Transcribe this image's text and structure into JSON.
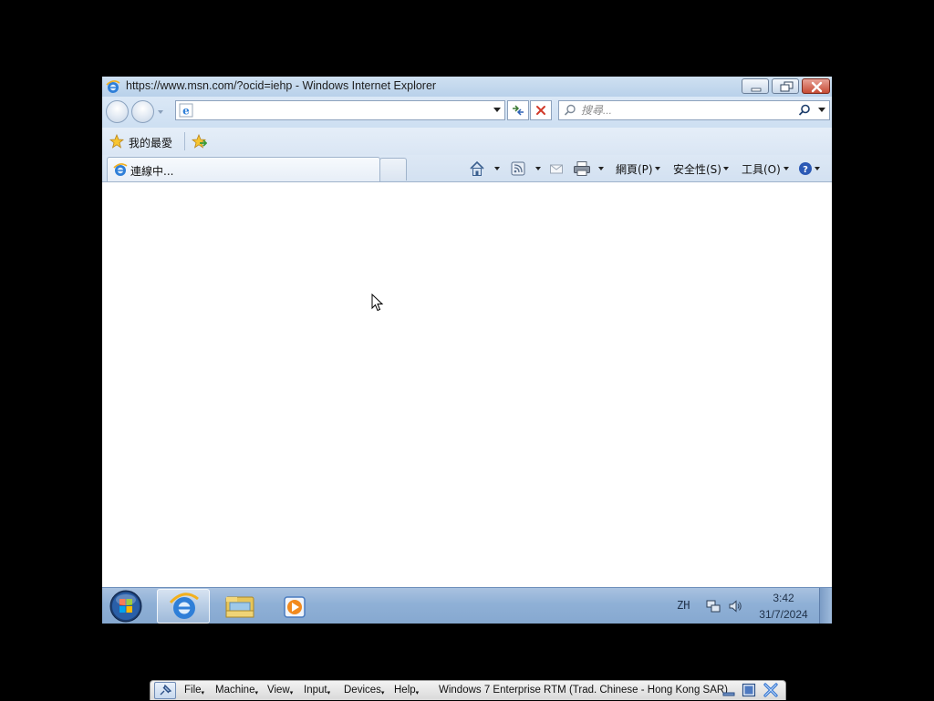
{
  "window": {
    "title": "https://www.msn.com/?ocid=iehp - Windows Internet Explorer"
  },
  "address_bar": {
    "value": ""
  },
  "search": {
    "placeholder": "搜尋..."
  },
  "favorites_bar": {
    "favorites_label": "我的最愛"
  },
  "tab": {
    "label": "連線中..."
  },
  "command_bar": {
    "page_label": "網頁(P)",
    "safety_label": "安全性(S)",
    "tools_label": "工具(O)"
  },
  "taskbar": {
    "items": [
      "internet-explorer",
      "windows-explorer",
      "windows-media-player"
    ],
    "active": "internet-explorer",
    "language": "ZH",
    "time": "3:42",
    "date": "31/7/2024"
  },
  "vbox_toolbar": {
    "menus": [
      "File",
      "Machine",
      "View",
      "Input",
      "Devices",
      "Help"
    ],
    "vm_title": "Windows 7 Enterprise RTM (Trad. Chinese - Hong Kong SAR)"
  }
}
